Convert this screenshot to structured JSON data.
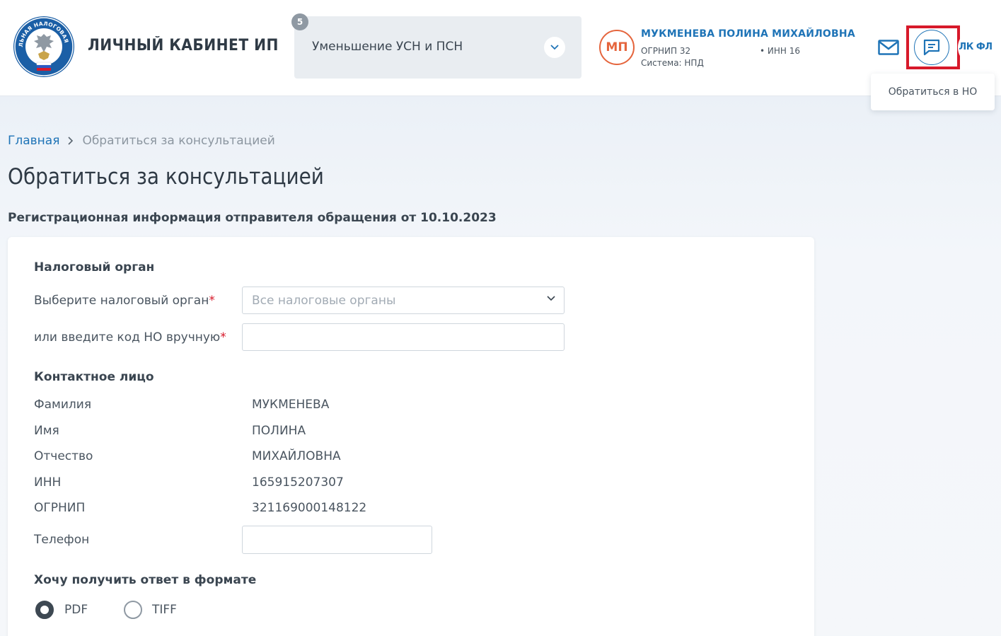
{
  "header": {
    "logo_text": "ФЕДЕРАЛЬНАЯ НАЛОГОВАЯ СЛУЖБА",
    "cabinet_title": "ЛИЧНЫЙ КАБИНЕТ ИП",
    "service": {
      "badge": "5",
      "label": "Уменьшение УСН и ПСН"
    },
    "user": {
      "initials": "МП",
      "name": "МУКМЕНЕВА ПОЛИНА МИХАЙЛОВНА",
      "ogrnip": "ОГРНИП 32",
      "inn": "• ИНН 16",
      "system": "Система: НПД"
    },
    "lkfl_label": "ЛК ФЛ",
    "tooltip": "Обратиться в НО"
  },
  "breadcrumb": {
    "home": "Главная",
    "current": "Обратиться за консультацией"
  },
  "page": {
    "title": "Обратиться за консультацией",
    "subtitle": "Регистрационная информация отправителя обращения от 10.10.2023"
  },
  "form": {
    "tax_section": "Налоговый орган",
    "tax_select_label": "Выберите налоговый орган",
    "tax_select_placeholder": "Все налоговые органы",
    "tax_code_label": "или введите код НО вручную",
    "required_mark": "*",
    "tax_code_value": "",
    "contact_section": "Контактное лицо",
    "contact_rows": [
      {
        "label": "Фамилия",
        "value": "МУКМЕНЕВА"
      },
      {
        "label": "Имя",
        "value": "ПОЛИНА"
      },
      {
        "label": "Отчество",
        "value": "МИХАЙЛОВНА"
      },
      {
        "label": "ИНН",
        "value": "165915207307"
      },
      {
        "label": "ОГРНИП",
        "value": "321169000148122"
      }
    ],
    "phone_label": "Телефон",
    "phone_value": "",
    "format_section": "Хочу получить ответ в формате",
    "format_options": [
      {
        "label": "PDF",
        "selected": true
      },
      {
        "label": "TIFF",
        "selected": false
      }
    ]
  },
  "colors": {
    "accent": "#1f74b7",
    "avatar": "#e5653d",
    "highlight": "#d7192a"
  }
}
